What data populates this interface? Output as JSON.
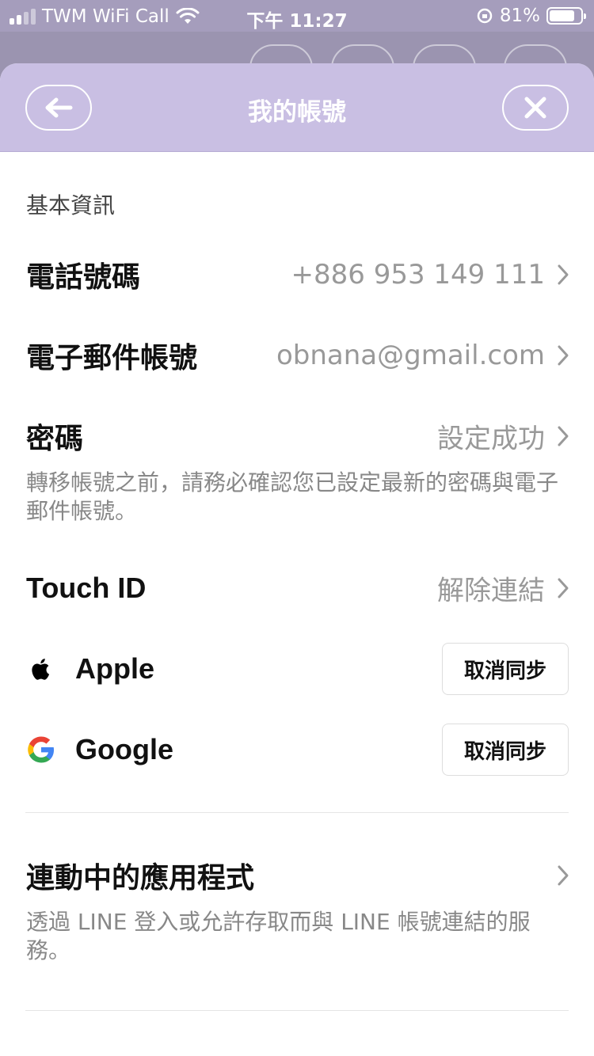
{
  "status_bar": {
    "carrier": "TWM WiFi Call",
    "time": "下午 11:27",
    "battery": "81%",
    "battery_level": 0.81
  },
  "header": {
    "title": "我的帳號",
    "back_icon": "arrow-left-icon",
    "close_icon": "close-icon"
  },
  "basic_info": {
    "section_label": "基本資訊",
    "phone": {
      "label": "電話號碼",
      "value": "+886 953 149 111"
    },
    "email": {
      "label": "電子郵件帳號",
      "value": "obnana@gmail.com"
    },
    "password": {
      "label": "密碼",
      "value": "設定成功",
      "note": "轉移帳號之前，請務必確認您已設定最新的密碼與電子郵件帳號。"
    },
    "touch_id": {
      "label": "Touch ID",
      "value": "解除連結"
    },
    "apple": {
      "label": "Apple",
      "button": "取消同步",
      "icon": "apple-icon"
    },
    "google": {
      "label": "Google",
      "button": "取消同步",
      "icon": "google-icon"
    }
  },
  "linked_apps": {
    "label": "連動中的應用程式",
    "note": "透過 LINE 登入或允許存取而與 LINE 帳號連結的服務。"
  },
  "colors": {
    "header_bg": "#c9bfe3",
    "status_bg": "#a59dbc",
    "value_text": "#999999"
  }
}
